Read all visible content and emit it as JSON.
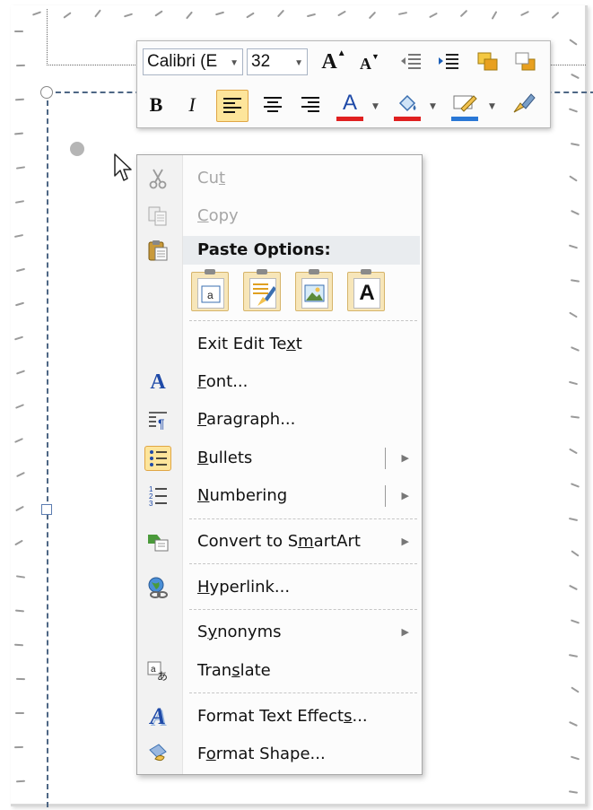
{
  "toolbar": {
    "font_name": "Calibri (E",
    "font_size": "32",
    "bold": "B",
    "italic": "I",
    "grow_font": "A",
    "shrink_font": "A",
    "font_color_glyph": "A"
  },
  "menu": {
    "cut": {
      "pre": "Cu",
      "key": "t",
      "post": ""
    },
    "copy": {
      "pre": "",
      "key": "C",
      "post": "opy"
    },
    "paste_options": "Paste Options:",
    "paste_text_only_glyph": "A",
    "exit_edit_text": {
      "pre": "Exit Edit Te",
      "key": "x",
      "post": "t"
    },
    "font": {
      "pre": "",
      "key": "F",
      "post": "ont..."
    },
    "paragraph": {
      "pre": "",
      "key": "P",
      "post": "aragraph..."
    },
    "bullets": {
      "pre": "",
      "key": "B",
      "post": "ullets"
    },
    "numbering": {
      "pre": "",
      "key": "N",
      "post": "umbering"
    },
    "convert_smartart": {
      "pre": "Convert to S",
      "key": "m",
      "post": "artArt"
    },
    "hyperlink": {
      "pre": "",
      "key": "H",
      "post": "yperlink..."
    },
    "synonyms": {
      "pre": "S",
      "key": "y",
      "post": "nonyms"
    },
    "translate": {
      "pre": "Tran",
      "key": "s",
      "post": "late"
    },
    "format_text_effects": {
      "pre": "Format Text Effect",
      "key": "s",
      "post": "..."
    },
    "format_shape": {
      "pre": "F",
      "key": "o",
      "post": "rmat Shape..."
    }
  },
  "colors": {
    "active_highlight": "#fde59b",
    "font_color_bar": "#e02020",
    "highlight_bar": "#e02020",
    "outline_bar": "#2a78d6"
  }
}
